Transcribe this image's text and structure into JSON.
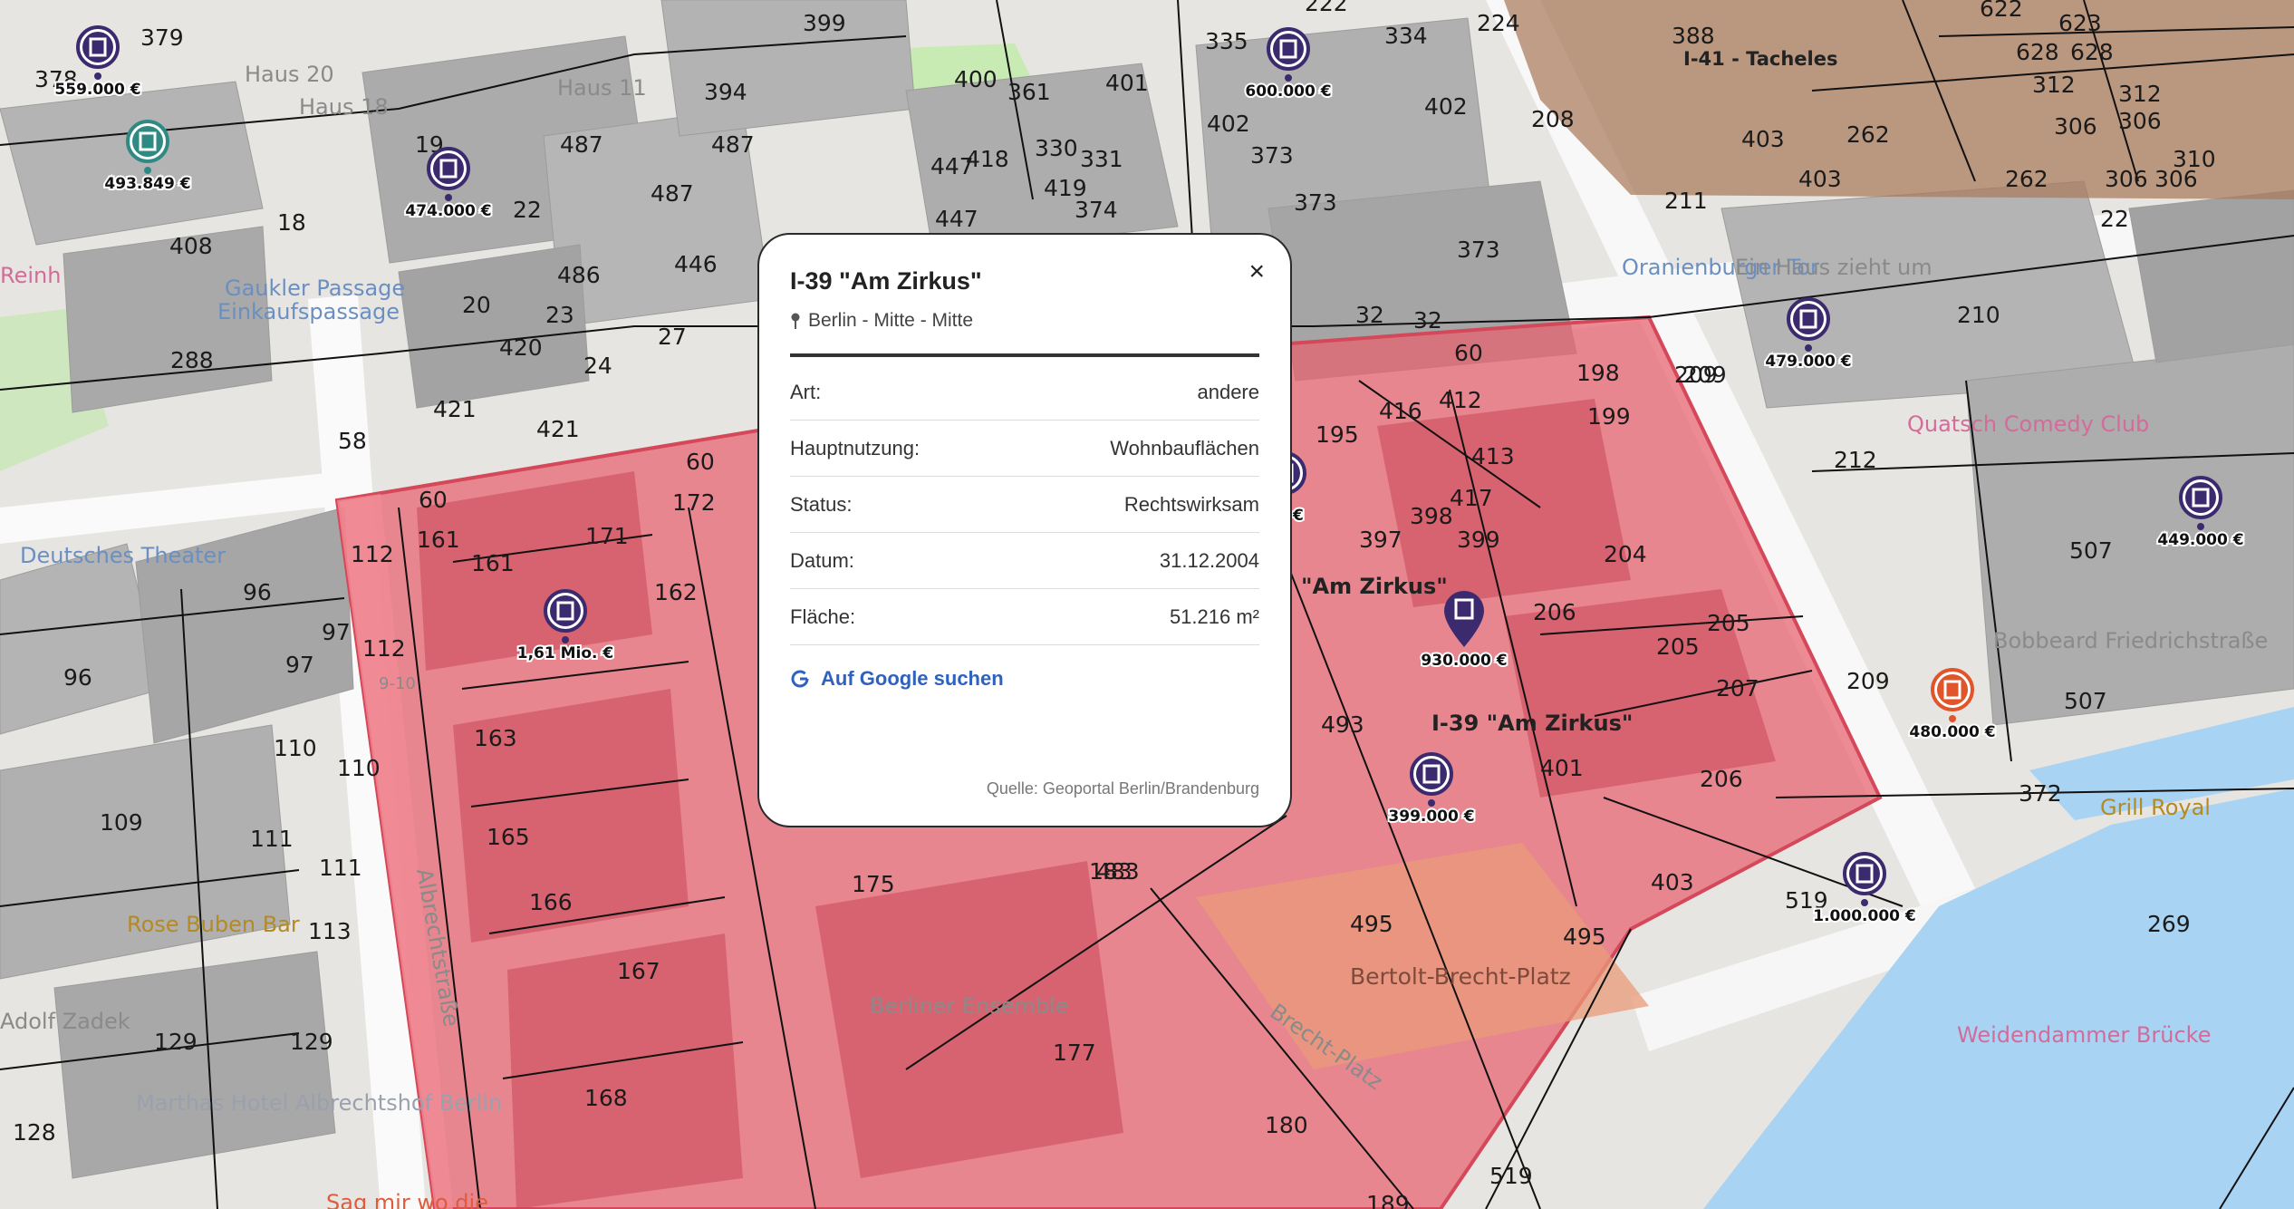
{
  "popup": {
    "title": "I-39 \"Am Zirkus\"",
    "location": "Berlin - Mitte - Mitte",
    "close_label": "×",
    "rows": [
      {
        "label": "Art:",
        "value": "andere"
      },
      {
        "label": "Hauptnutzung:",
        "value": "Wohnbauflächen"
      },
      {
        "label": "Status:",
        "value": "Rechtswirksam"
      },
      {
        "label": "Datum:",
        "value": "31.12.2004"
      },
      {
        "label": "Fläche:",
        "value": "51.216 m²"
      }
    ],
    "google_label": "Auf Google suchen",
    "source": "Quelle: Geoportal Berlin/Brandenburg"
  },
  "map": {
    "colors": {
      "plan_area_red": "#e9616f",
      "plan_area_brown": "#a97a5a",
      "water": "#a8d3f3",
      "park": "#cdeab8",
      "marker": "#3b2a6e",
      "marker_orange": "#e0562a"
    },
    "plan_labels": [
      "I-39 \"Am Zirkus\"",
      "I-41 - Tacheles",
      "\"Am Zirkus\""
    ],
    "prices": [
      "559.000 €",
      "493.849 €",
      "474.000 €",
      "600.000 €",
      "479.000 €",
      "449.000 €",
      "1,61 Mio. €",
      "930.000 €",
      "399.000 €",
      "480.000 €",
      "1.000.000 €",
      "io. €"
    ],
    "streets": [
      "Albrechtstraße",
      "Brecht-Platz",
      "Bertolt-Brecht-Platz",
      "Haus 20",
      "Haus 18",
      "Haus 11",
      "Einkaufspassage",
      "Oranienburger Tor",
      "Ein Haus zieht um",
      "Quatsch Comedy Club",
      "Deutsches Theater",
      "Gaukler Passage",
      "Weidendammer Brücke",
      "Grill Royal",
      "Bobbeard Friedrichstraße",
      "Rose Buben Bar",
      "Marthas Hotel Albrechtshof Berlin",
      "Sag mir wo die",
      "Adolf Zadek",
      "Reinh",
      "Berliner Ensemble",
      "Haus",
      "9-10",
      "Friedrichstraße"
    ],
    "parcels": [
      "378",
      "379",
      "399",
      "400",
      "361",
      "401",
      "222",
      "334",
      "335",
      "224",
      "388",
      "622",
      "623",
      "628",
      "628",
      "312",
      "312",
      "306",
      "306",
      "262",
      "306",
      "306",
      "310",
      "403",
      "403",
      "262",
      "22",
      "208",
      "211",
      "394",
      "487",
      "487",
      "487",
      "19",
      "18",
      "408",
      "22",
      "486",
      "446",
      "20",
      "23",
      "27",
      "24",
      "420",
      "288",
      "421",
      "421",
      "58",
      "60",
      "60",
      "172",
      "171",
      "161",
      "161",
      "112",
      "112",
      "96",
      "97",
      "97",
      "162",
      "163",
      "165",
      "166",
      "167",
      "168",
      "175",
      "177",
      "180",
      "189",
      "183",
      "110",
      "110",
      "111",
      "111",
      "113",
      "96",
      "109",
      "129",
      "129",
      "128",
      "195",
      "416",
      "412",
      "198",
      "199",
      "413",
      "417",
      "398",
      "399",
      "397",
      "204",
      "206",
      "205",
      "205",
      "207",
      "206",
      "209",
      "209",
      "212",
      "210",
      "209",
      "493",
      "401",
      "403",
      "519",
      "519",
      "495",
      "495",
      "269",
      "507",
      "507",
      "372",
      "483",
      "447",
      "418",
      "330",
      "331",
      "419",
      "447",
      "374",
      "373",
      "373",
      "373",
      "402",
      "402",
      "32",
      "32",
      "60",
      "163",
      "165"
    ]
  }
}
